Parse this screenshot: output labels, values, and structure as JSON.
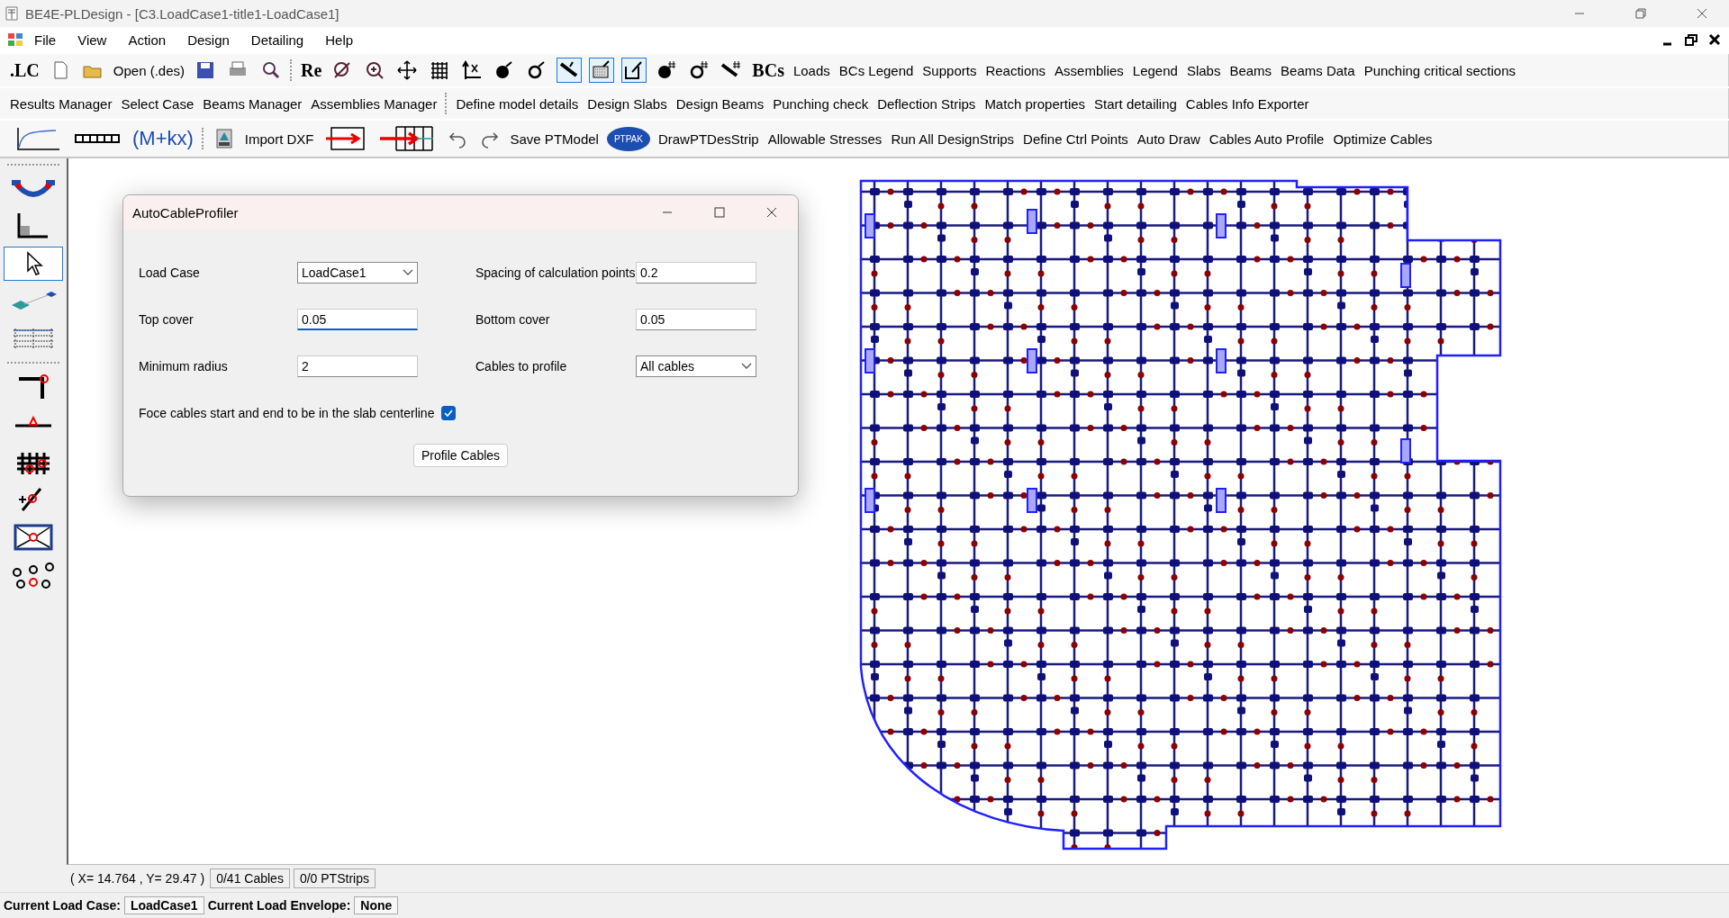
{
  "window": {
    "title": "BE4E-PLDesign - [C3.LoadCase1-title1-LoadCase1]"
  },
  "menu": [
    "File",
    "View",
    "Action",
    "Design",
    "Detailing",
    "Help"
  ],
  "toolbars": [
    [
      {
        "kind": "bold",
        "label": ".LC"
      },
      {
        "kind": "icon",
        "selected": false
      },
      {
        "kind": "icon",
        "selected": false
      },
      {
        "kind": "text",
        "label": "Open (.des)"
      },
      {
        "kind": "icon",
        "selected": false
      },
      {
        "kind": "icon",
        "selected": false
      },
      {
        "kind": "icon",
        "selected": false
      },
      {
        "kind": "separator"
      },
      {
        "kind": "bold",
        "label": "Re"
      },
      {
        "kind": "icon",
        "selected": false
      },
      {
        "kind": "icon",
        "selected": false
      },
      {
        "kind": "icon",
        "selected": false
      },
      {
        "kind": "icon",
        "selected": false
      },
      {
        "kind": "icon",
        "selected": false
      },
      {
        "kind": "icon",
        "selected": false
      },
      {
        "kind": "icon",
        "selected": false
      },
      {
        "kind": "icon",
        "selected": true
      },
      {
        "kind": "icon",
        "selected": true
      },
      {
        "kind": "icon",
        "selected": true
      },
      {
        "kind": "icon",
        "selected": false
      },
      {
        "kind": "icon",
        "selected": false
      },
      {
        "kind": "icon",
        "selected": false
      },
      {
        "kind": "bold",
        "label": "BCs"
      },
      {
        "kind": "text",
        "label": "Loads"
      },
      {
        "kind": "text",
        "label": "BCs Legend"
      },
      {
        "kind": "text",
        "label": "Supports"
      },
      {
        "kind": "text",
        "label": "Reactions"
      },
      {
        "kind": "text",
        "label": "Assemblies"
      },
      {
        "kind": "text",
        "label": "Legend"
      },
      {
        "kind": "text",
        "label": "Slabs"
      },
      {
        "kind": "text",
        "label": "Beams"
      },
      {
        "kind": "text",
        "label": "Beams Data"
      },
      {
        "kind": "text",
        "label": "Punching critical sections"
      }
    ],
    [
      {
        "kind": "text",
        "label": "Results Manager"
      },
      {
        "kind": "text",
        "label": "Select Case"
      },
      {
        "kind": "text",
        "label": "Beams Manager"
      },
      {
        "kind": "text",
        "label": "Assemblies Manager"
      },
      {
        "kind": "separator"
      },
      {
        "kind": "text",
        "label": "Define model details"
      },
      {
        "kind": "text",
        "label": "Design Slabs"
      },
      {
        "kind": "text",
        "label": "Design Beams"
      },
      {
        "kind": "text",
        "label": "Punching check"
      },
      {
        "kind": "text",
        "label": "Deflection Strips"
      },
      {
        "kind": "text",
        "label": "Match properties"
      },
      {
        "kind": "text",
        "label": "Start detailing"
      },
      {
        "kind": "text",
        "label": "Cables Info Exporter"
      }
    ],
    [
      {
        "kind": "icon",
        "selected": false
      },
      {
        "kind": "icon",
        "selected": false
      },
      {
        "kind": "formula",
        "label": "(M+kx)"
      },
      {
        "kind": "separator"
      },
      {
        "kind": "icon",
        "selected": false
      },
      {
        "kind": "text",
        "label": "Import DXF"
      },
      {
        "kind": "icon",
        "selected": false
      },
      {
        "kind": "icon",
        "selected": false
      },
      {
        "kind": "icon",
        "selected": false
      },
      {
        "kind": "icon",
        "selected": false
      },
      {
        "kind": "text",
        "label": "Save PTModel"
      },
      {
        "kind": "badge",
        "label": "PTPAK"
      },
      {
        "kind": "text",
        "label": "DrawPTDesStrip"
      },
      {
        "kind": "text",
        "label": "Allowable Stresses"
      },
      {
        "kind": "text",
        "label": "Run All DesignStrips"
      },
      {
        "kind": "text",
        "label": "Define Ctrl Points"
      },
      {
        "kind": "text",
        "label": "Auto Draw"
      },
      {
        "kind": "text",
        "label": "Cables Auto Profile"
      },
      {
        "kind": "text",
        "label": "Optimize Cables"
      }
    ]
  ],
  "sidebar": [
    {
      "kind": "separator"
    },
    {
      "kind": "icon",
      "selected": false
    },
    {
      "kind": "icon",
      "selected": false
    },
    {
      "kind": "icon",
      "selected": true
    },
    {
      "kind": "icon",
      "selected": false
    },
    {
      "kind": "icon",
      "selected": false
    },
    {
      "kind": "separator"
    },
    {
      "kind": "icon",
      "selected": false
    },
    {
      "kind": "icon",
      "selected": false
    },
    {
      "kind": "icon",
      "selected": false
    },
    {
      "kind": "icon",
      "selected": false
    },
    {
      "kind": "icon",
      "selected": false
    },
    {
      "kind": "icon",
      "selected": false
    }
  ],
  "dialog": {
    "title": "AutoCableProfiler",
    "fields": [
      {
        "label": "Load Case",
        "kind": "dropdown",
        "value": "LoadCase1",
        "focused": false
      },
      {
        "label": "Spacing of calculation points",
        "kind": "input",
        "value": "0.2",
        "focused": false
      },
      {
        "label": "Top cover",
        "kind": "input",
        "value": "0.05",
        "focused": true
      },
      {
        "label": "Bottom cover",
        "kind": "input",
        "value": "0.05",
        "focused": false
      },
      {
        "label": "Minimum radius",
        "kind": "input",
        "value": "2",
        "focused": false
      },
      {
        "label": "Cables to profile",
        "kind": "dropdown",
        "value": "All cables",
        "focused": false
      }
    ],
    "checkbox": {
      "label": "Foce cables start and end to be in the slab centerline",
      "checked": true
    },
    "button": "Profile Cables"
  },
  "status_bar": {
    "coordinates": "( X= 14.764 , Y= 29.47 )",
    "cells": [
      "0/41 Cables",
      "0/0 PTStrips"
    ]
  },
  "bottom_bar": [
    {
      "label": "Current Load Case:",
      "value": "LoadCase1"
    },
    {
      "label": "Current Load Envelope:",
      "value": "None"
    }
  ]
}
